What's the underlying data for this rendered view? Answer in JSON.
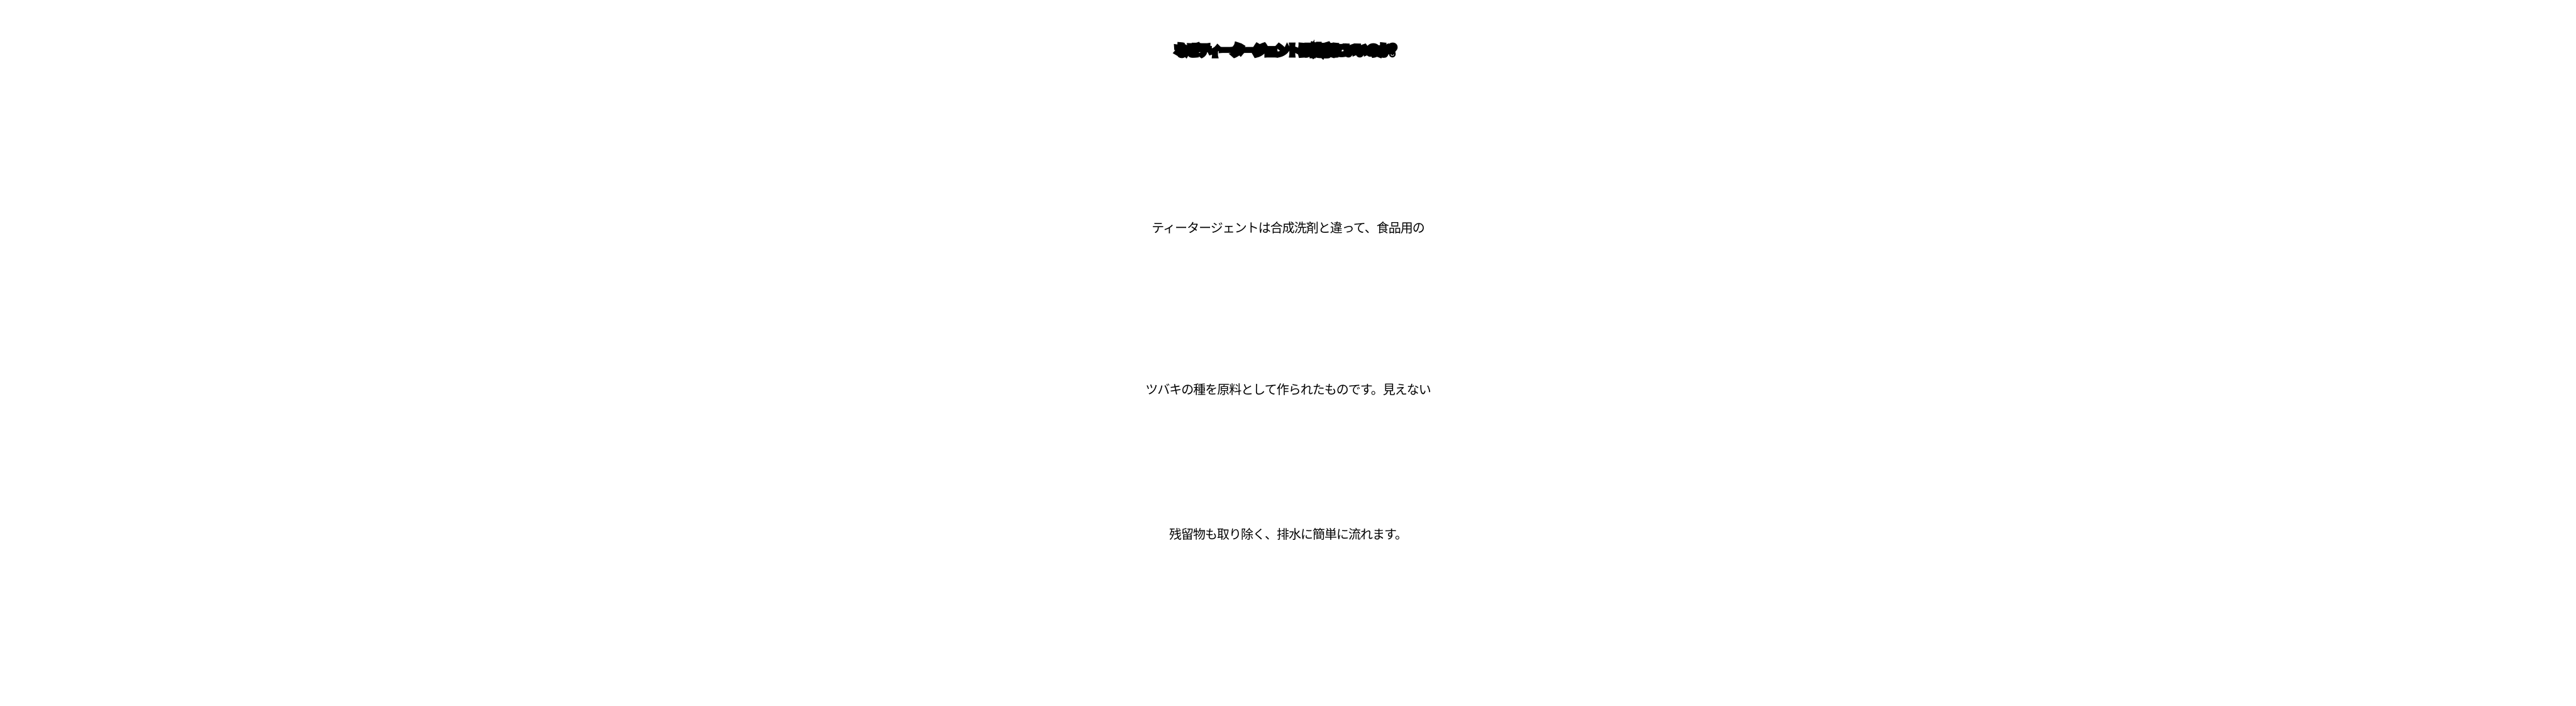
{
  "heading": "なぜティータージェントは健康にいいのか？",
  "body_lines": [
    "ティータージェントは合成洗剤と違って、食品用の",
    "ツバキの種を原料として作られたものです。見えない",
    "残留物も取り除く、排水に簡単に流れます。"
  ]
}
